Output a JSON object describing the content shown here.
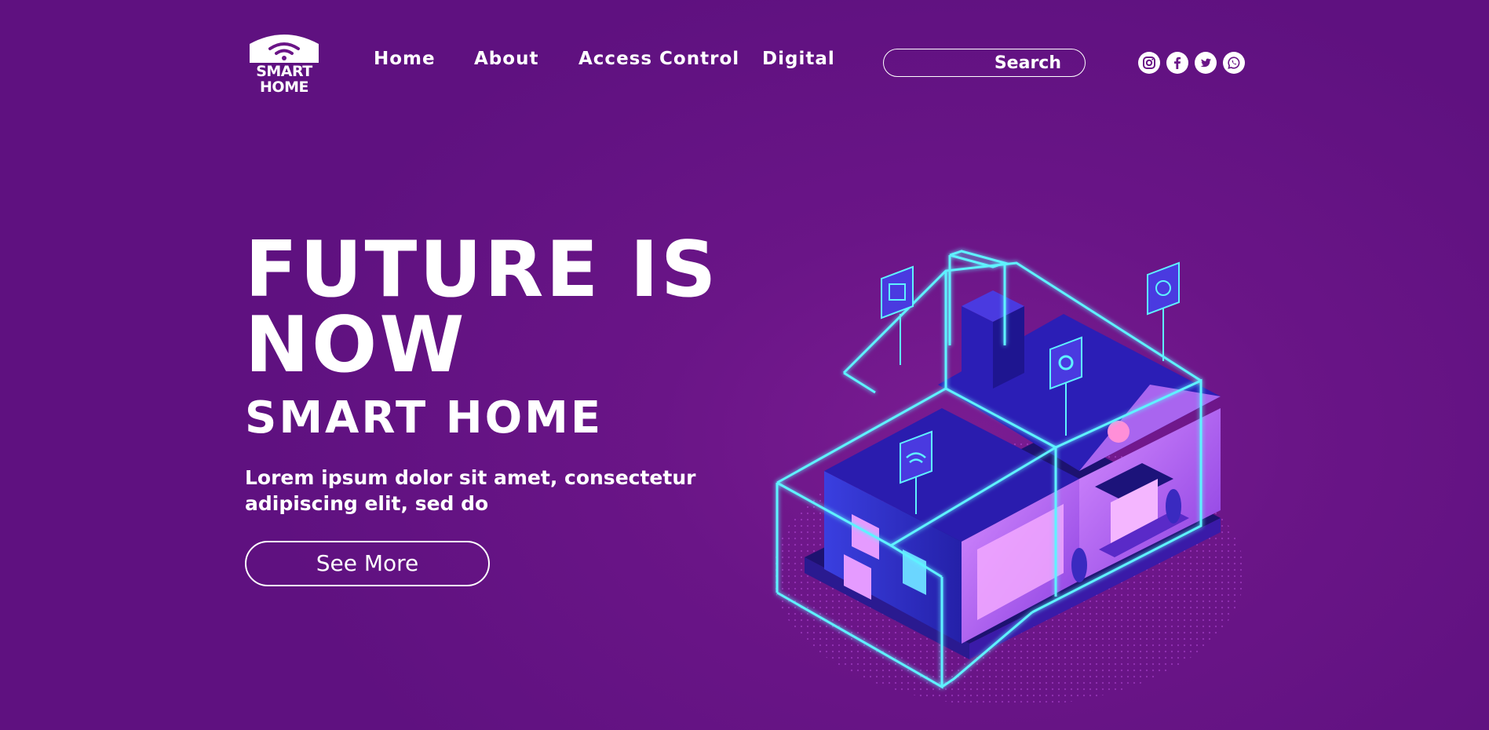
{
  "brand": {
    "line1": "SMART",
    "line2": "HOME"
  },
  "nav": {
    "home": "Home",
    "about": "About",
    "access_control": "Access Control",
    "digital": "Digital"
  },
  "search": {
    "label": "Search",
    "placeholder": ""
  },
  "social": [
    "instagram-icon",
    "facebook-icon",
    "twitter-icon",
    "whatsapp-icon"
  ],
  "hero": {
    "title_line1": "FUTURE IS",
    "title_line2": "NOW",
    "subtitle": "SMART HOME",
    "body_line1": "Lorem ipsum dolor sit amet, consectetur",
    "body_line2": "adipiscing elit, sed do",
    "cta": "See More"
  },
  "colors": {
    "background": "#6a1587",
    "neon": "#5ff2ff",
    "roof": "#2a1aa0",
    "wall_pink": "#c874ff"
  }
}
